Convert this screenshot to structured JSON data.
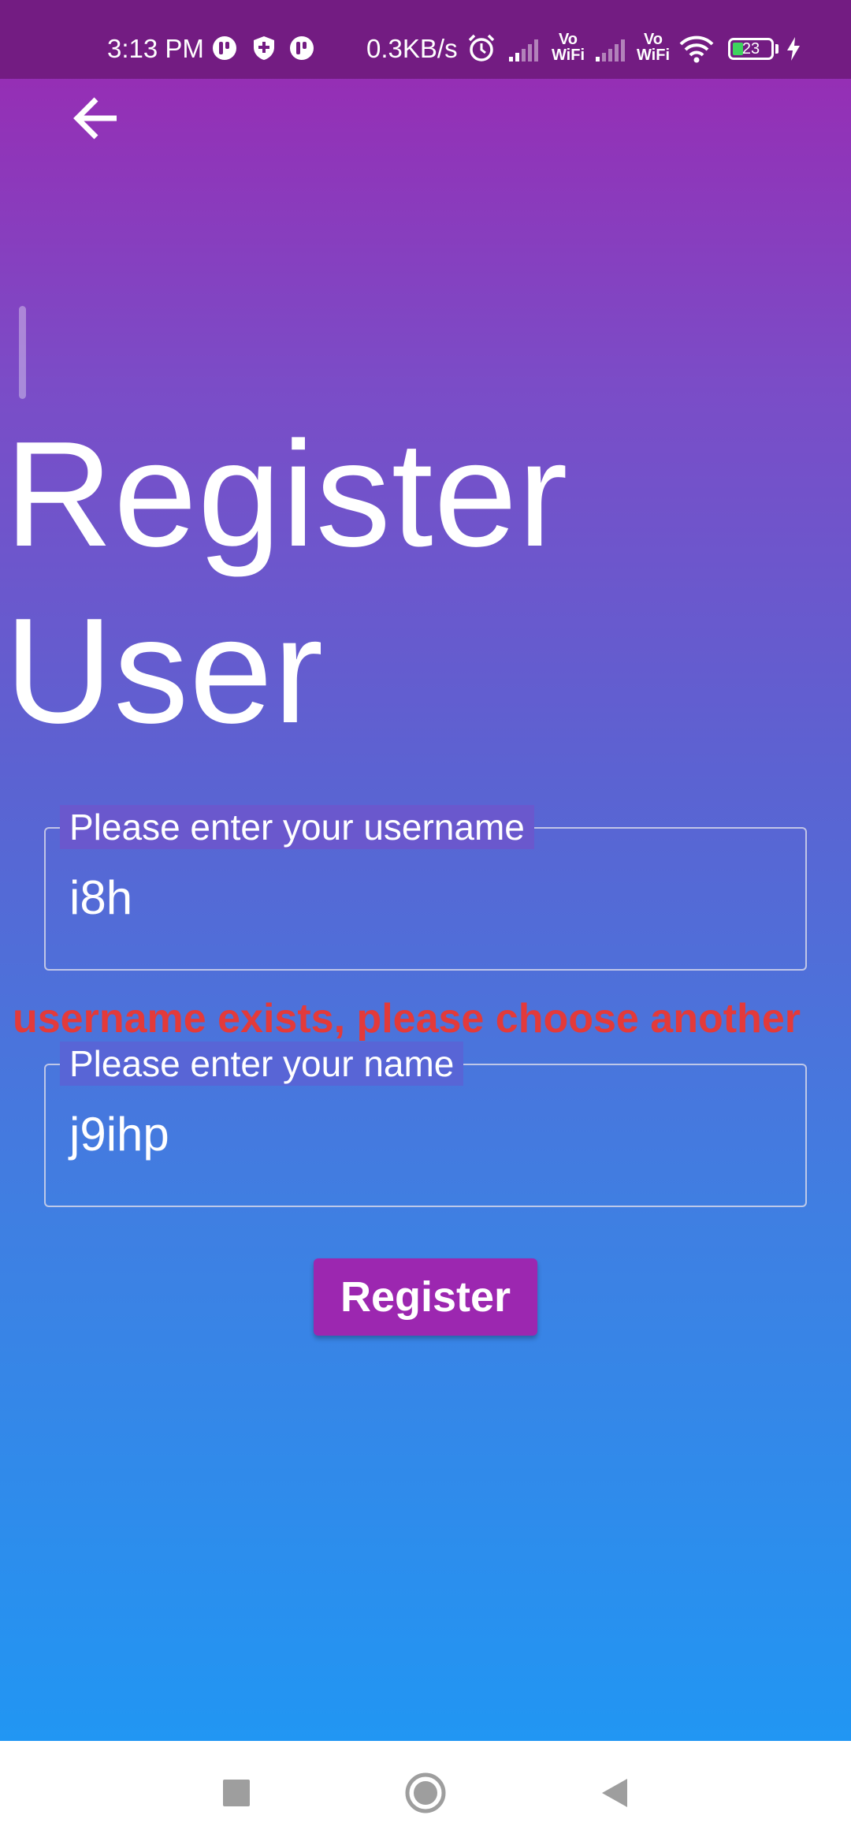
{
  "status_bar": {
    "time": "3:13 PM",
    "net_speed": "0.3KB/s",
    "sim1_label_top": "Vo",
    "sim1_label_bottom": "WiFi",
    "sim2_label_top": "Vo",
    "sim2_label_bottom": "WiFi",
    "battery_level": "23",
    "icons": [
      "app-notification-icon",
      "shield-icon",
      "app-notification-icon",
      "alarm-icon",
      "signal-icon",
      "signal-icon",
      "wifi-icon",
      "battery-icon",
      "charging-icon"
    ]
  },
  "header": {
    "back_icon": "arrow-left-icon"
  },
  "page": {
    "title_line1": "Register",
    "title_line2": "User"
  },
  "form": {
    "username_label": "Please enter your username",
    "username_value": "i8h",
    "error_message": "username exists, please choose another",
    "name_label": "Please enter your name",
    "name_value": "j9ihp",
    "register_label": "Register"
  },
  "nav_bar": {
    "icons": [
      "recents-square-icon",
      "home-circle-icon",
      "back-triangle-icon"
    ]
  },
  "colors": {
    "status_bar": "#731c82",
    "gradient_top": "#9c27b0",
    "gradient_bottom": "#2196f3",
    "error": "#e33a3a",
    "button": "#9c27b0"
  }
}
